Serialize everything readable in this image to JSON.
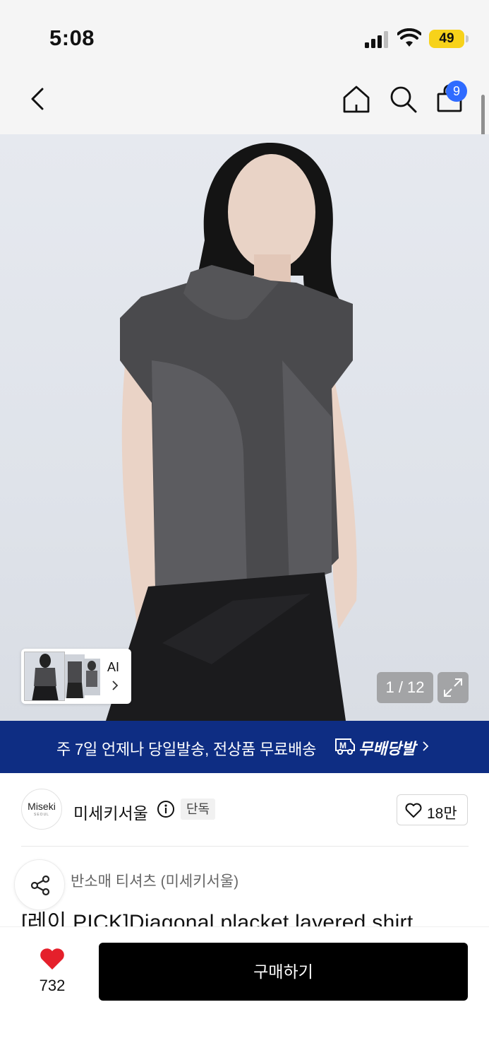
{
  "status_bar": {
    "time": "5:08",
    "battery": "49"
  },
  "nav": {
    "cart_count": "9",
    "icons": [
      "back-icon",
      "home-icon",
      "search-icon",
      "shopping-bag-icon"
    ]
  },
  "gallery": {
    "thumb_label": "AI",
    "counter": "1 / 12"
  },
  "promo": {
    "text": "주 7일 언제나 당일발송, 전상품 무료배송",
    "brand": "무배당발"
  },
  "seller": {
    "logo_text": "Miseki",
    "logo_sub": "SEOUL",
    "name": "미세키서울",
    "badge": "단독",
    "likes": "18만"
  },
  "product": {
    "category": "반소매 티셔츠 (미세키서울)",
    "title": "[레이 PICK]Diagonal placket layered shirt"
  },
  "bottom_bar": {
    "wish_count": "732",
    "buy_label": "구매하기"
  },
  "colors": {
    "promo_bg": "#0e2d83",
    "badge_blue": "#2f6bff",
    "heart_red": "#e5202b",
    "battery_yellow": "#f7d21a"
  }
}
